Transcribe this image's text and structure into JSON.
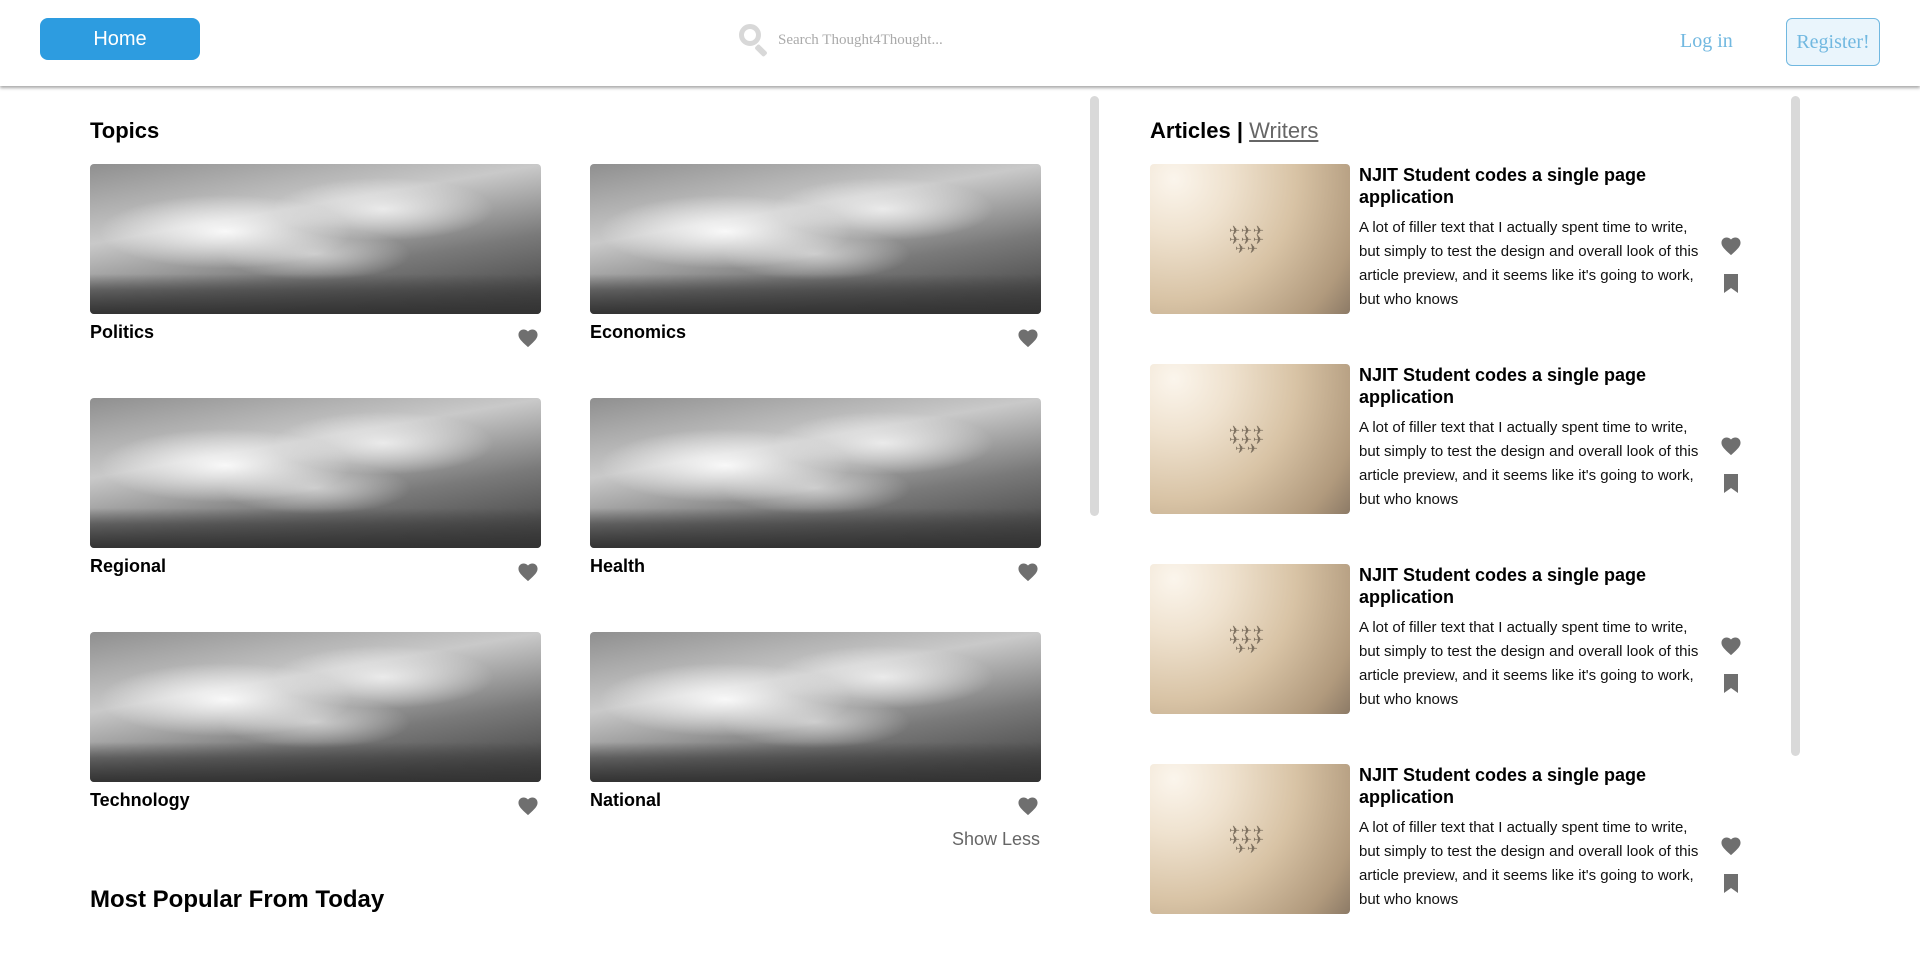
{
  "header": {
    "home_label": "Home",
    "search_placeholder": "Search Thought4Thought...",
    "login_label": "Log in",
    "register_label": "Register!"
  },
  "topics": {
    "title": "Topics",
    "items": [
      {
        "name": "Politics"
      },
      {
        "name": "Economics"
      },
      {
        "name": "Regional"
      },
      {
        "name": "Health"
      },
      {
        "name": "Technology"
      },
      {
        "name": "National"
      }
    ],
    "show_less_label": "Show Less"
  },
  "popular": {
    "title": "Most Popular From Today"
  },
  "articles": {
    "title": "Articles",
    "separator": "|",
    "writers_label": "Writers",
    "items": [
      {
        "title": "NJIT Student codes a single page application",
        "text": "A lot of filler text that I actually spent time to write, but simply to test the design and overall look of this article preview, and it seems like it's going to work, but who knows"
      },
      {
        "title": "NJIT Student codes a single page application",
        "text": "A lot of filler text that I actually spent time to write, but simply to test the design and overall look of this article preview, and it seems like it's going to work, but who knows"
      },
      {
        "title": "NJIT Student codes a single page application",
        "text": "A lot of filler text that I actually spent time to write, but simply to test the design and overall look of this article preview, and it seems like it's going to work, but who knows"
      },
      {
        "title": "NJIT Student codes a single page application",
        "text": "A lot of filler text that I actually spent time to write, but simply to test the design and overall look of this article preview, and it seems like it's going to work, but who knows"
      }
    ]
  },
  "icons": {
    "search": "search-icon",
    "like": "heart-icon",
    "save": "bookmark-icon"
  },
  "colors": {
    "accent": "#2d9ce0",
    "link": "#71b8e0",
    "icon": "#6f6f6f"
  }
}
